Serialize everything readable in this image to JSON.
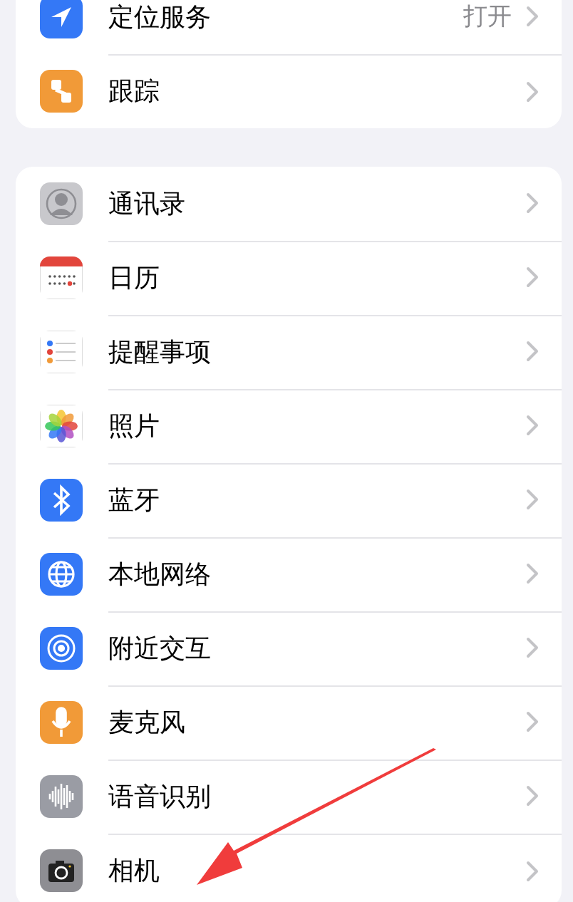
{
  "groups": [
    {
      "items": [
        {
          "kind": "location",
          "label": "定位服务",
          "value": "打开"
        },
        {
          "kind": "tracking",
          "label": "跟踪"
        }
      ]
    },
    {
      "items": [
        {
          "kind": "contacts",
          "label": "通讯录"
        },
        {
          "kind": "calendar",
          "label": "日历"
        },
        {
          "kind": "reminders",
          "label": "提醒事项"
        },
        {
          "kind": "photos",
          "label": "照片"
        },
        {
          "kind": "bluetooth",
          "label": "蓝牙"
        },
        {
          "kind": "network",
          "label": "本地网络"
        },
        {
          "kind": "nearby",
          "label": "附近交互"
        },
        {
          "kind": "microphone",
          "label": "麦克风"
        },
        {
          "kind": "speech",
          "label": "语音识别"
        },
        {
          "kind": "camera",
          "label": "相机"
        }
      ]
    }
  ],
  "annotation": {
    "kind": "arrow"
  }
}
